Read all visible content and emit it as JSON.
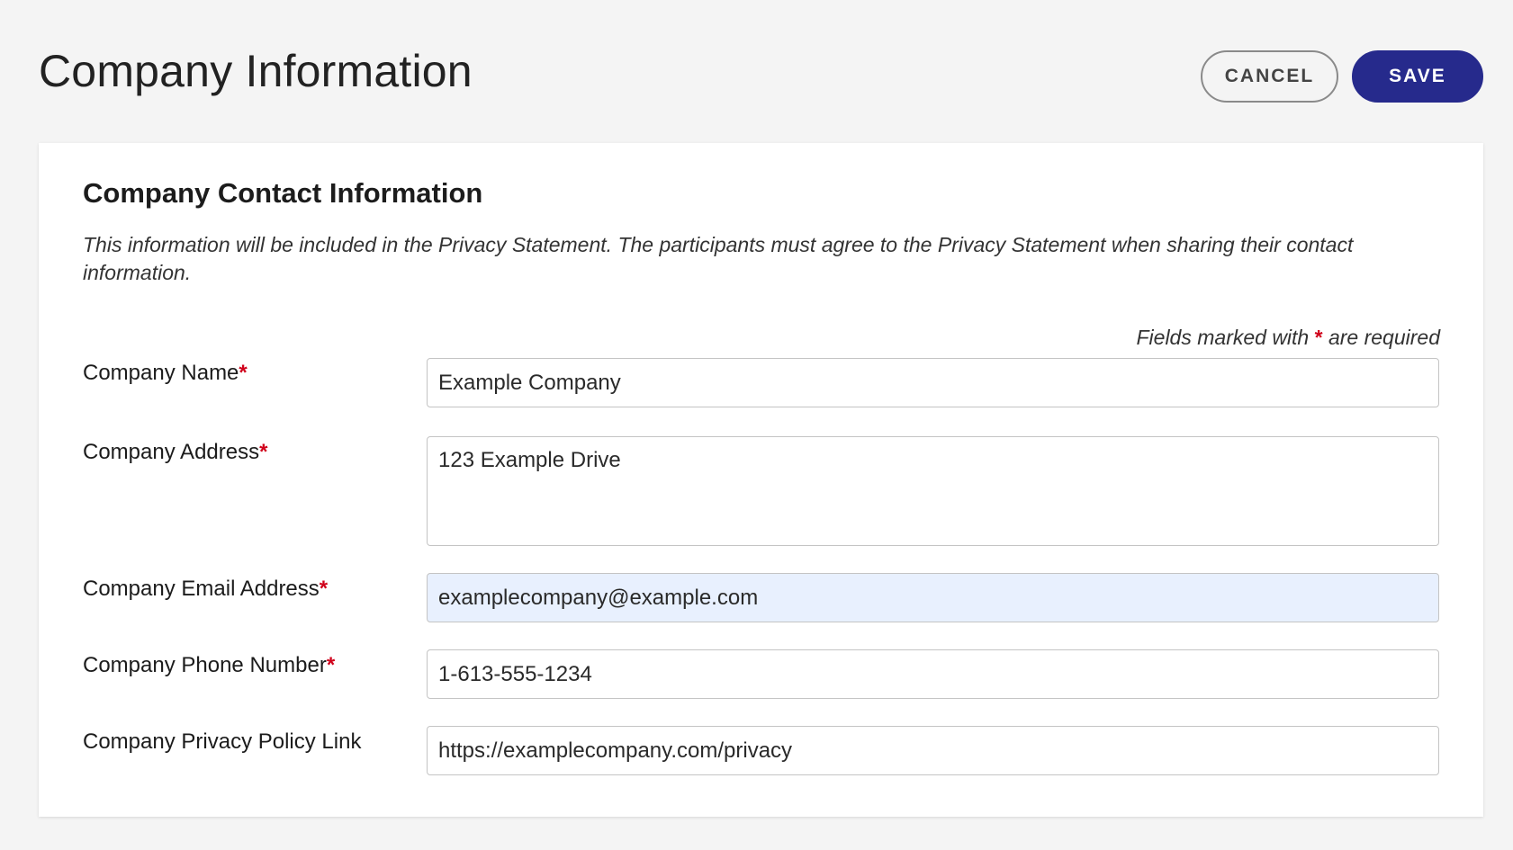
{
  "header": {
    "title": "Company Information",
    "cancel_label": "CANCEL",
    "save_label": "SAVE"
  },
  "section": {
    "title": "Company Contact Information",
    "description": "This information will be included in the Privacy Statement. The participants must agree to the Privacy Statement when sharing their contact information.",
    "required_note_prefix": "Fields marked with",
    "required_note_star": "*",
    "required_note_suffix": "are required"
  },
  "fields": {
    "company_name": {
      "label": "Company Name",
      "required_mark": "*",
      "value": "Example Company"
    },
    "company_address": {
      "label": "Company Address",
      "required_mark": "*",
      "value": "123 Example Drive"
    },
    "company_email": {
      "label": "Company Email Address",
      "required_mark": "*",
      "value": "examplecompany@example.com"
    },
    "company_phone": {
      "label": "Company Phone Number",
      "required_mark": "*",
      "value": "1-613-555-1234"
    },
    "company_privacy_link": {
      "label": "Company Privacy Policy Link",
      "value": "https://examplecompany.com/privacy"
    }
  },
  "colors": {
    "primary": "#262a8c",
    "required": "#d0021b",
    "autofill_bg": "#e8f0fe",
    "page_bg": "#f4f4f4"
  }
}
